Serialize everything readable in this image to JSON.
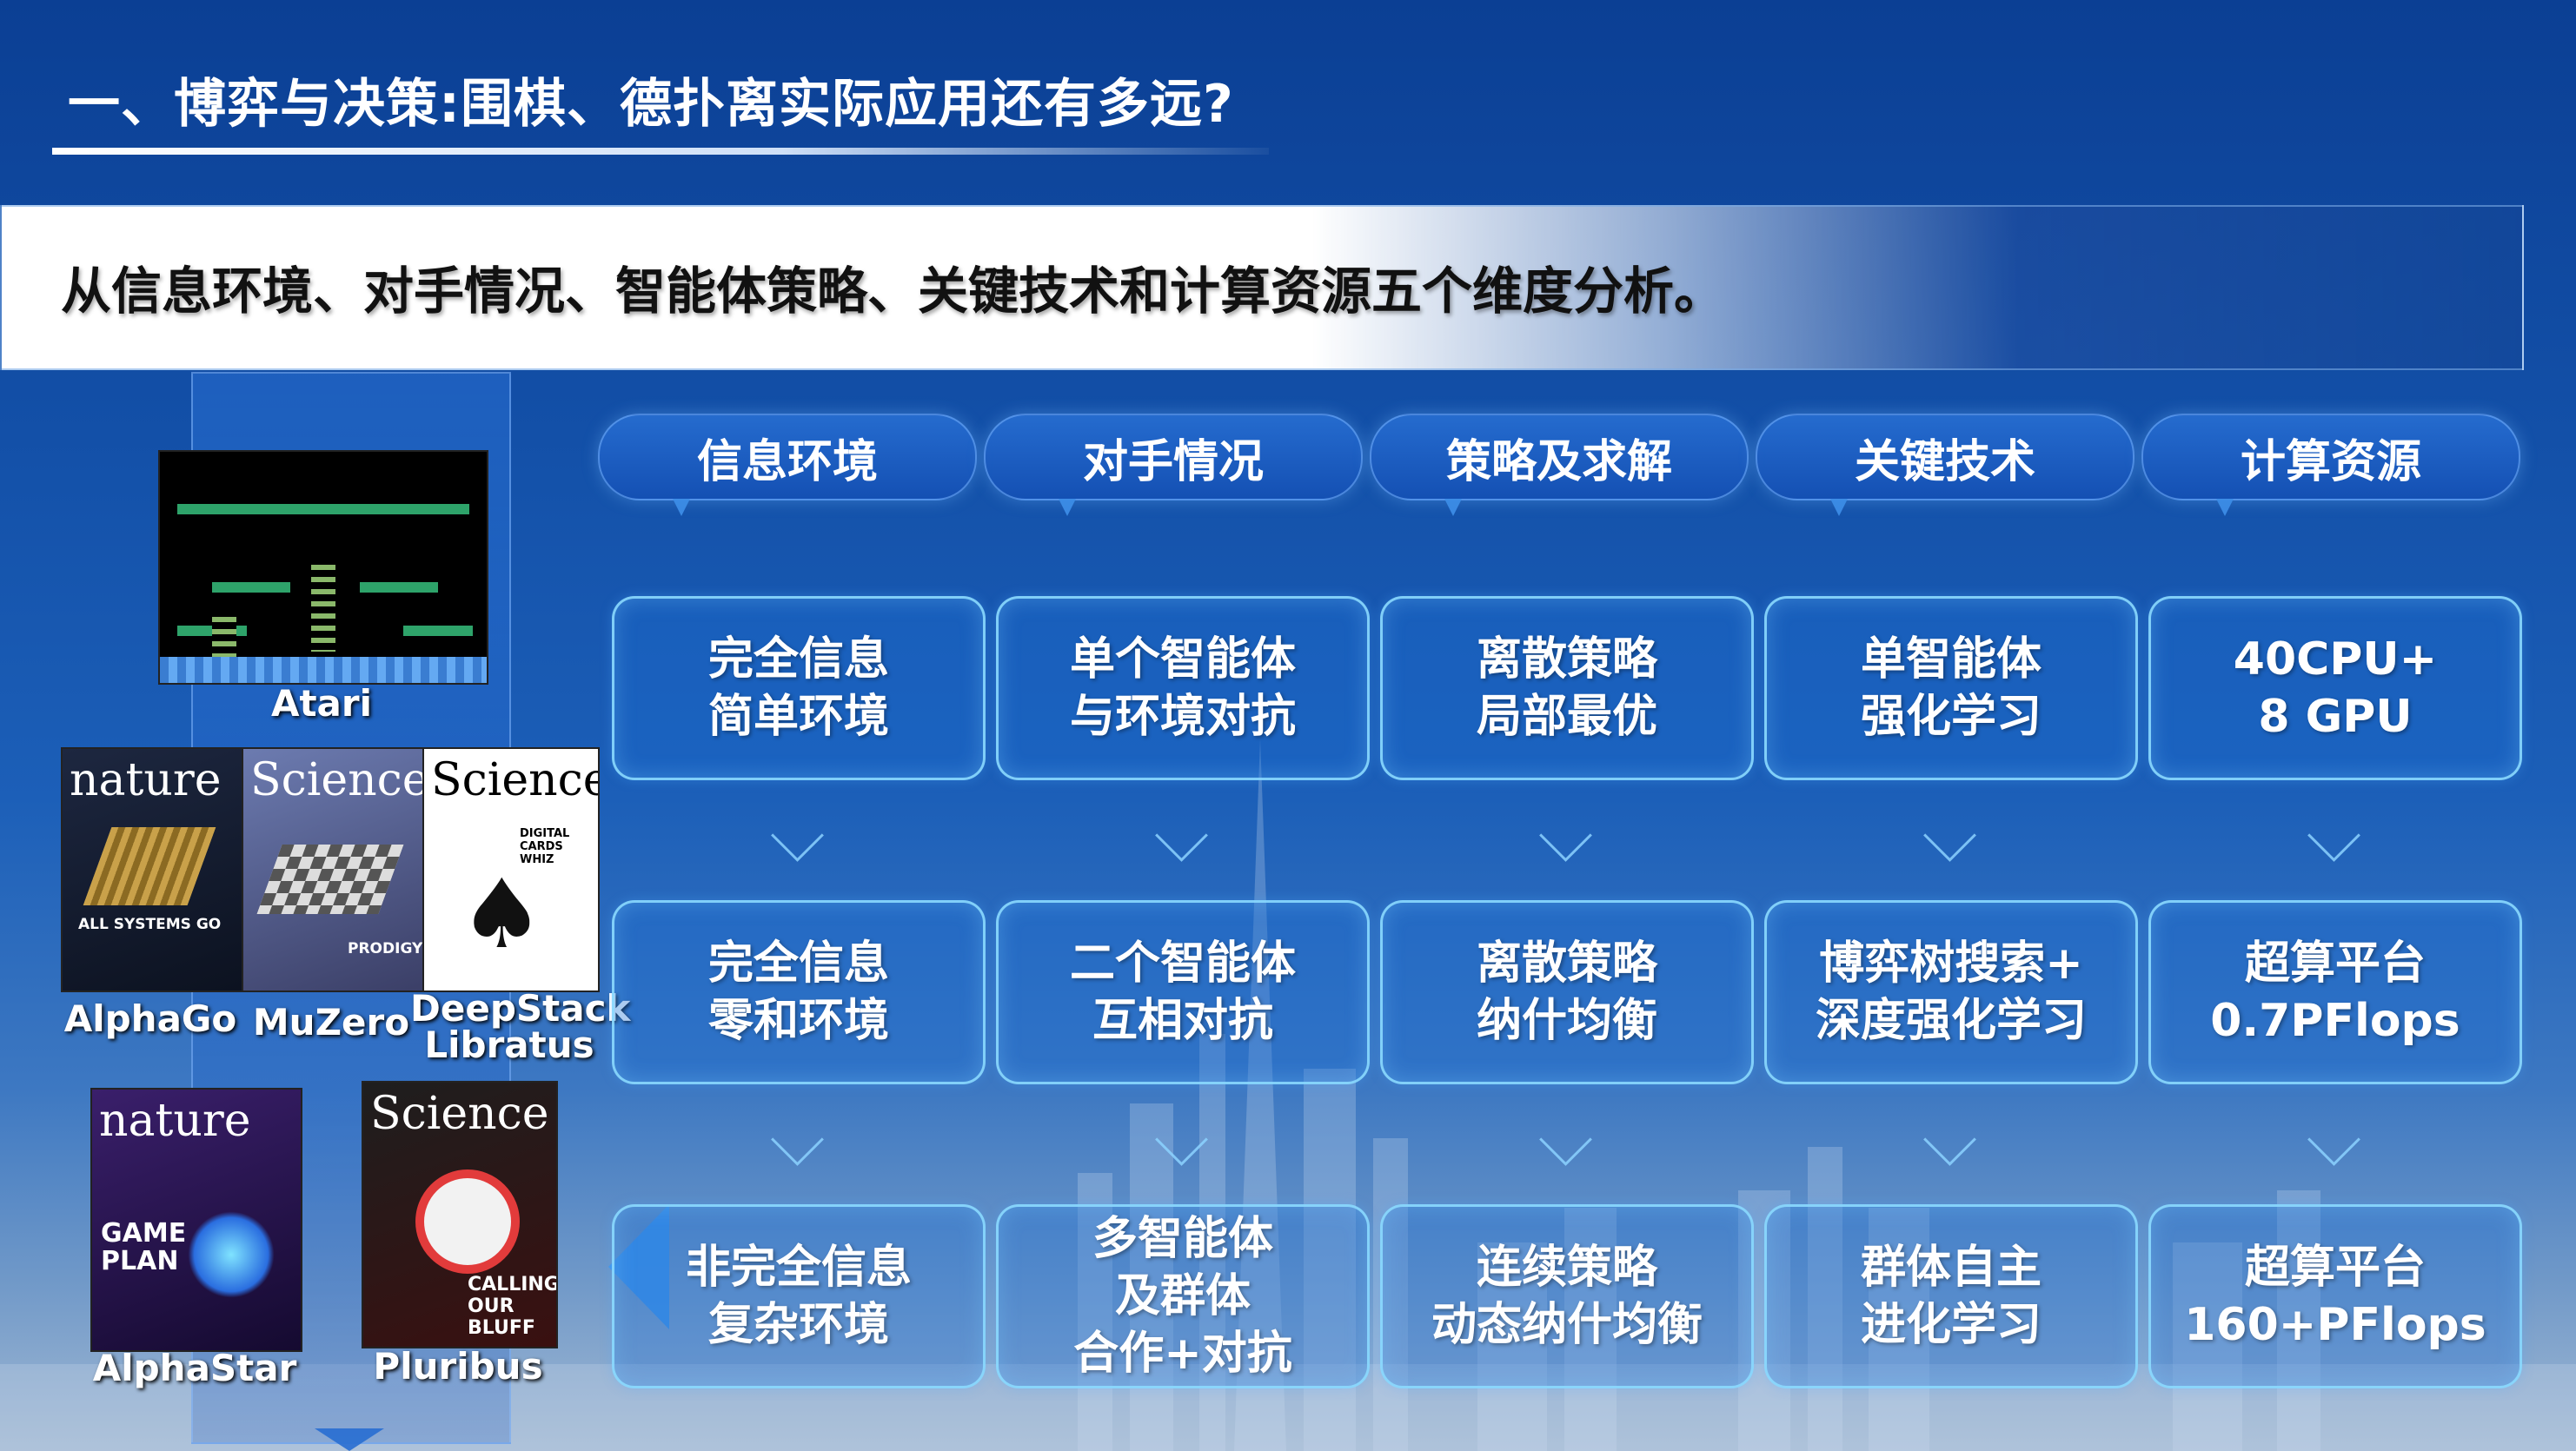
{
  "header": {
    "title": "一、博弈与决策:围棋、德扑离实际应用还有多远?"
  },
  "banner": {
    "text": "从信息环境、对手情况、智能体策略、关键技术和计算资源五个维度分析。"
  },
  "left_panel": {
    "captions": {
      "atari": "Atari",
      "alphago": "AlphaGo",
      "muzero": "MuZero",
      "deepstack_line1": "DeepStack",
      "deepstack_line2": "Libratus",
      "alphastar": "AlphaStar",
      "pluribus": "Pluribus"
    },
    "covers": {
      "nature1": {
        "masthead": "nature",
        "text": "ALL SYSTEMS GO"
      },
      "science1": {
        "masthead": "Science",
        "text": "PRODIGY"
      },
      "science2": {
        "masthead": "Science",
        "text": "DIGITAL CARDS WHIZ"
      },
      "nature2": {
        "masthead": "nature",
        "text": "GAME PLAN"
      },
      "science3": {
        "masthead": "Science",
        "text": "CALLING OUR BLUFF"
      }
    }
  },
  "columns": [
    {
      "header": "信息环境",
      "cells": [
        [
          "完全信息",
          "简单环境"
        ],
        [
          "完全信息",
          "零和环境"
        ],
        [
          "非完全信息",
          "复杂环境"
        ]
      ]
    },
    {
      "header": "对手情况",
      "cells": [
        [
          "单个智能体",
          "与环境对抗"
        ],
        [
          "二个智能体",
          "互相对抗"
        ],
        [
          "多智能体",
          "及群体",
          "合作+对抗"
        ]
      ]
    },
    {
      "header": "策略及求解",
      "cells": [
        [
          "离散策略",
          "局部最优"
        ],
        [
          "离散策略",
          "纳什均衡"
        ],
        [
          "连续策略",
          "动态纳什均衡"
        ]
      ]
    },
    {
      "header": "关键技术",
      "cells": [
        [
          "单智能体",
          "强化学习"
        ],
        [
          "博弈树搜索+",
          "深度强化学习"
        ],
        [
          "群体自主",
          "进化学习"
        ]
      ]
    },
    {
      "header": "计算资源",
      "cells": [
        [
          "40CPU+",
          "8 GPU"
        ],
        [
          "超算平台",
          "0.7PFlops"
        ],
        [
          "超算平台",
          "160+PFlops"
        ]
      ]
    }
  ],
  "colors": {
    "background": "#1350a8",
    "cell_border": "#8cdcff",
    "header_fill": "#2a6ed2"
  }
}
